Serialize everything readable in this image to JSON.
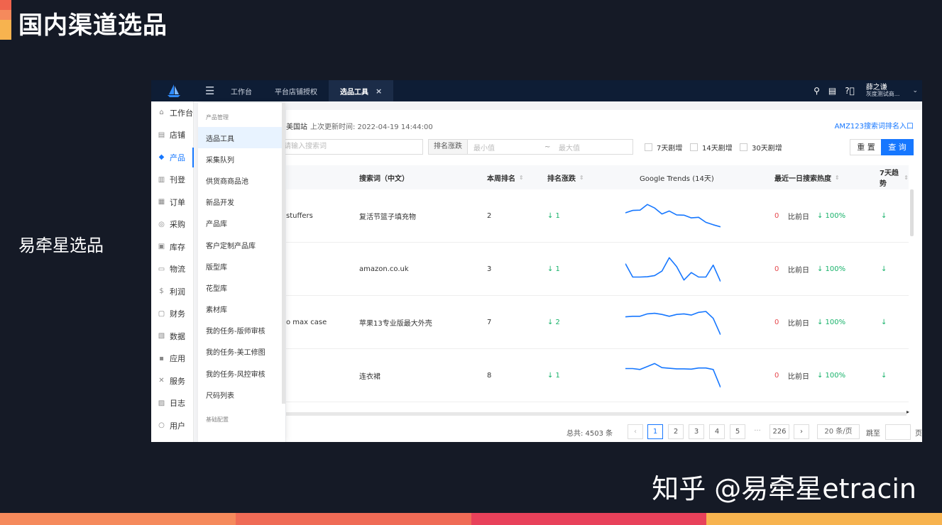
{
  "slide": {
    "title": "国内渠道选品",
    "side_label": "易牵星选品",
    "watermark": "知乎 @易牵星etracin",
    "accent_colors": [
      "#f0644d",
      "#f58a5c",
      "#f7b34f"
    ],
    "stripe_colors": [
      "#f58a5c",
      "#ef6b56",
      "#e8415a",
      "#f7b34f"
    ]
  },
  "app": {
    "topbar": {
      "tabs": [
        {
          "label": "工作台"
        },
        {
          "label": "平台店铺授权"
        },
        {
          "label": "选品工具",
          "close": "×"
        }
      ],
      "user_name": "薛之谦",
      "user_org": "灰度测试商..."
    },
    "sidebar": {
      "items": [
        {
          "label": "工作台",
          "icon": "⌂"
        },
        {
          "label": "店铺",
          "icon": "▤"
        },
        {
          "label": "产品",
          "icon": "◆"
        },
        {
          "label": "刊登",
          "icon": "▥"
        },
        {
          "label": "订单",
          "icon": "▦"
        },
        {
          "label": "采购",
          "icon": "◎"
        },
        {
          "label": "库存",
          "icon": "▣"
        },
        {
          "label": "物流",
          "icon": "▭"
        },
        {
          "label": "利润",
          "icon": "$"
        },
        {
          "label": "财务",
          "icon": "▢"
        },
        {
          "label": "数据",
          "icon": "▧"
        },
        {
          "label": "应用",
          "icon": "▪"
        },
        {
          "label": "服务",
          "icon": "✕"
        },
        {
          "label": "日志",
          "icon": "▨"
        },
        {
          "label": "用户",
          "icon": "○"
        }
      ]
    },
    "submenu": {
      "group": "产品管理",
      "items": [
        {
          "label": "选品工具"
        },
        {
          "label": "采集队列"
        },
        {
          "label": "供货商商品池"
        },
        {
          "label": "新品开发"
        },
        {
          "label": "产品库"
        },
        {
          "label": "客户定制产品库"
        },
        {
          "label": "版型库"
        },
        {
          "label": "花型库"
        },
        {
          "label": "素材库"
        },
        {
          "label": "我的任务-版师审核"
        },
        {
          "label": "我的任务-美工修图"
        },
        {
          "label": "我的任务-风控审核"
        },
        {
          "label": "尺码列表"
        }
      ],
      "group2": "基础配置"
    },
    "filters": {
      "site": "美国站",
      "updated": "上次更新时间: 2022-04-19 14:44:00",
      "amz_link": "AMZ123搜索词排名入口",
      "search_placeholder": "请输入搜索词",
      "range_label": "排名涨跌",
      "min_placeholder": "最小值",
      "sep": "~",
      "max_placeholder": "最大值",
      "checks": [
        "7天剧增",
        "14天剧增",
        "30天剧增"
      ],
      "reset": "重 置",
      "query": "查 询"
    },
    "table": {
      "headers": {
        "keyword_cn": "搜索词（中文）",
        "rank": "本周排名",
        "change": "排名涨跌",
        "trends": "Google Trends (14天)",
        "heat": "最近一日搜索热度",
        "trend7": "7天趋势"
      },
      "rows": [
        {
          "keyword_en": "stuffers",
          "keyword_cn": "复活节篮子填充物",
          "rank": "2",
          "change": "↓ 1",
          "heat": "0",
          "compare": "比前日",
          "pct": "↓ 100%",
          "trend7": "↓",
          "trends": [
            62,
            70,
            71,
            90,
            78,
            58,
            68,
            55,
            54,
            45,
            47,
            30,
            22,
            15
          ]
        },
        {
          "keyword_en": "",
          "keyword_cn": "amazon.co.uk",
          "rank": "3",
          "change": "↓ 1",
          "heat": "0",
          "compare": "比前日",
          "pct": "↓ 100%",
          "trend7": "↓",
          "trends": [
            70,
            25,
            25,
            26,
            30,
            45,
            90,
            60,
            15,
            40,
            25,
            25,
            65,
            10
          ]
        },
        {
          "keyword_en": "o max case",
          "keyword_cn": "苹果13专业版最大外壳",
          "rank": "7",
          "change": "↓ 2",
          "heat": "0",
          "compare": "比前日",
          "pct": "↓ 100%",
          "trend7": "↓",
          "trends": [
            70,
            72,
            72,
            80,
            82,
            78,
            72,
            78,
            80,
            76,
            85,
            88,
            65,
            10
          ]
        },
        {
          "keyword_en": "",
          "keyword_cn": "连衣裙",
          "rank": "8",
          "change": "↓ 1",
          "heat": "0",
          "compare": "比前日",
          "pct": "↓ 100%",
          "trend7": "↓",
          "trends": [
            75,
            75,
            72,
            82,
            92,
            78,
            76,
            74,
            74,
            73,
            77,
            77,
            72,
            12
          ]
        }
      ]
    },
    "pagination": {
      "total": "总共:  4503 条",
      "prev": "‹",
      "pages": [
        "1",
        "2",
        "3",
        "4",
        "5"
      ],
      "ellipsis": "···",
      "last": "226",
      "next": "›",
      "page_size": "20 条/页",
      "jump_label": "跳至",
      "page_suffix": "页",
      "current": "1"
    }
  }
}
